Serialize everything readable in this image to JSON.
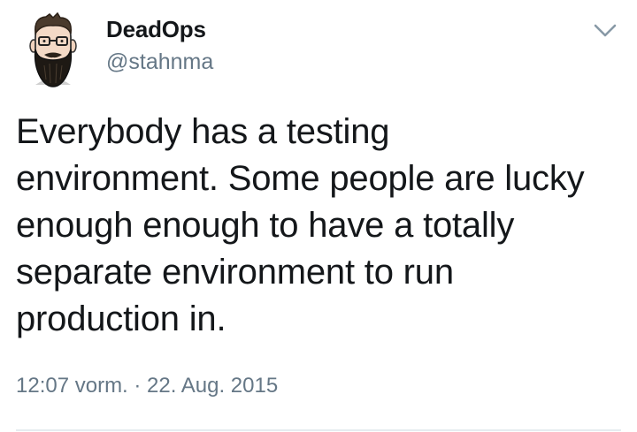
{
  "tweet": {
    "author": {
      "display_name": "DeadOps",
      "handle": "@stahnma",
      "avatar_icon": "bearded-man-avatar"
    },
    "menu_icon": "chevron-down-icon",
    "text_lines": [
      "Everybody has a testing",
      "environment. Some people are lucky",
      "enough enough to have a totally",
      "separate environment to run",
      "production in."
    ],
    "timestamp": "12:07 vorm. · 22. Aug. 2015"
  },
  "colors": {
    "text": "#14171a",
    "secondary_text": "#657786",
    "divider": "#e6ecf0"
  }
}
